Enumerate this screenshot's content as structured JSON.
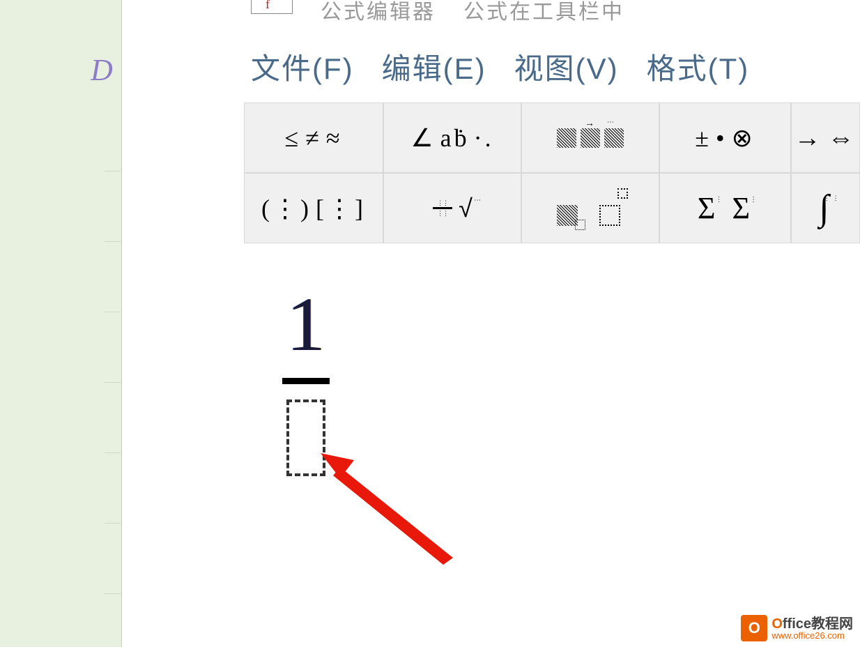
{
  "menubar": {
    "file": "文件(F)",
    "edit": "编辑(E)",
    "view": "视图(V)",
    "format": "格式(T)"
  },
  "toolbar_row1": {
    "g1": {
      "sym1": "≤",
      "sym2": "≠",
      "sym3": "≈"
    },
    "g2": {
      "sym1": "∆",
      "sym2": "aḃ",
      "sym3": "·."
    },
    "g4": {
      "sym1": "±",
      "sym2": "•",
      "sym3": "⊗"
    },
    "g5": {
      "sym1": "→",
      "sym2": "⇔"
    }
  },
  "toolbar_row2": {
    "g1": {
      "fences1": "(⋮)",
      "fences2": "[⋮]"
    },
    "g2": {
      "sqrt": "√"
    },
    "g4": {
      "sum1": "Σ",
      "sum2": "Σ"
    },
    "g5": {
      "int": "∫"
    }
  },
  "equation": {
    "numerator": "1",
    "denominator_placeholder": ""
  },
  "watermark": {
    "icon_letter": "O",
    "title_first": "O",
    "title_rest": "ffice教程网",
    "url": "www.office26.com"
  },
  "cutoff": {
    "text1": "公式编辑器",
    "text2": "公式在工具栏中"
  },
  "sidebar_fragment": "D"
}
